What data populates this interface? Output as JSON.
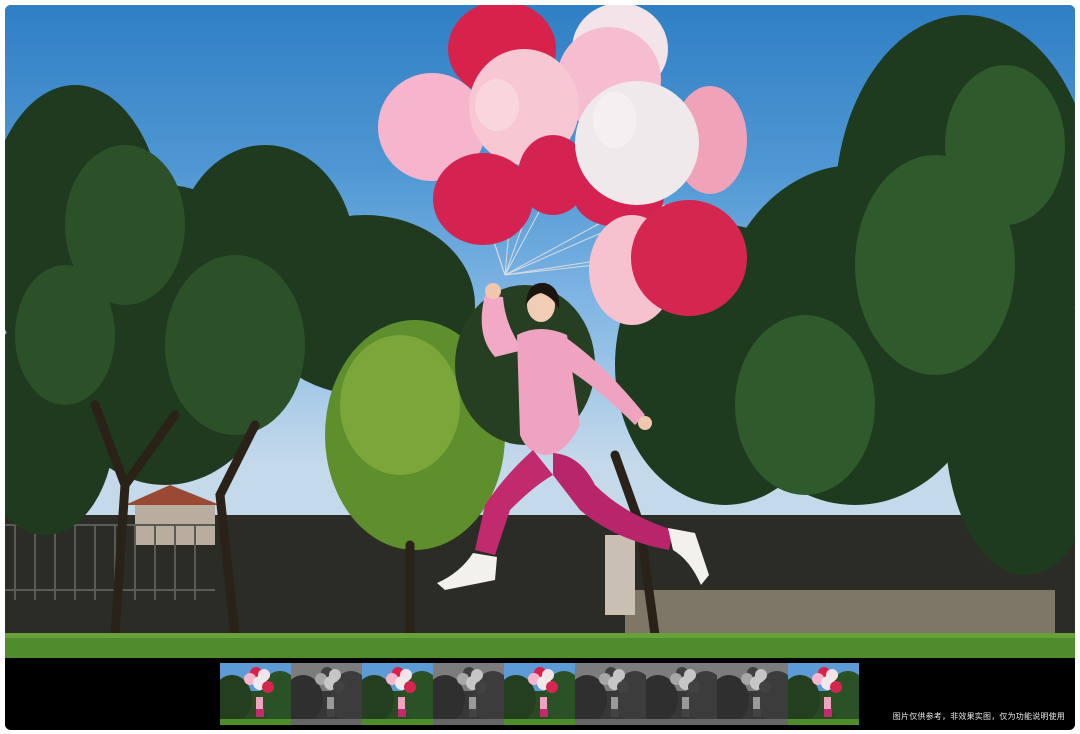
{
  "viewer": {
    "disclaimer": "图片仅供参考，非效果实图，仅为功能说明使用"
  },
  "filmstrip": {
    "selected_index": 2,
    "thumbnails": [
      {
        "style": "color"
      },
      {
        "style": "mono"
      },
      {
        "style": "color"
      },
      {
        "style": "mono"
      },
      {
        "style": "color"
      },
      {
        "style": "mono"
      },
      {
        "style": "mono"
      },
      {
        "style": "mono"
      },
      {
        "style": "color"
      }
    ]
  },
  "colors": {
    "sky_top": "#2f7fc4",
    "grass": "#4f8d2c",
    "suit_pink": "#f1a7c4",
    "pants_magenta": "#c02a6d",
    "balloon_red": "#d9244f",
    "balloon_pink": "#f6b6cd",
    "balloon_white": "#f3ecee"
  }
}
